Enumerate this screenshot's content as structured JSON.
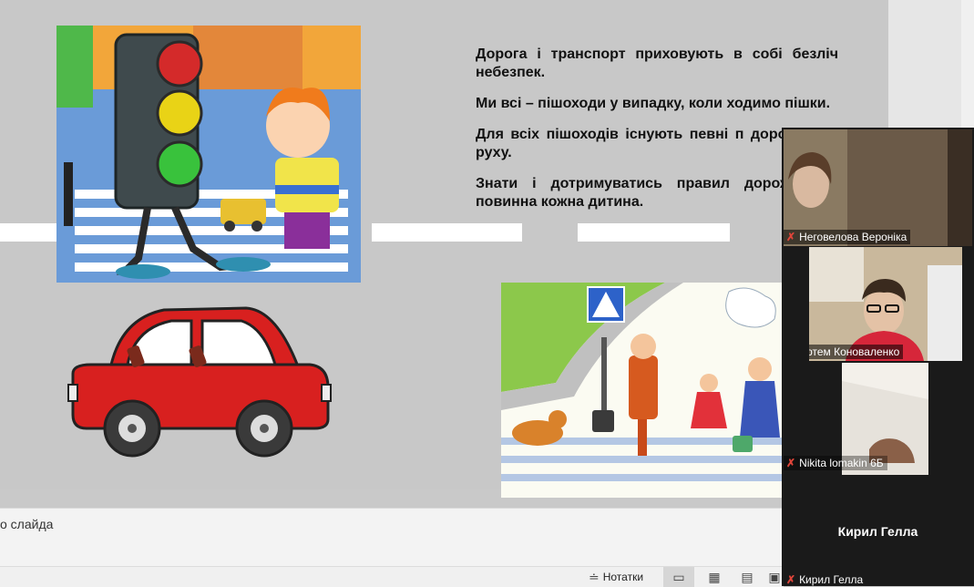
{
  "slide": {
    "paragraphs": [
      "Дорога і транспорт приховують в собі безліч небезпек.",
      "Ми всі – пішоходи у випадку, коли ходимо пішки.",
      "Для всіх пішоходів існують певні п дорожнього руху.",
      "Знати і дотримуватись правил дорож руху повинна кожна дитина."
    ]
  },
  "notes": {
    "placeholder_fragment": "о слайда"
  },
  "statusbar": {
    "notes_label": "Нотатки",
    "icons": [
      "notes-icon",
      "normal-view-icon",
      "slide-sorter-icon",
      "reading-view-icon",
      "slideshow-icon"
    ]
  },
  "colors": {
    "car_red": "#d8201f",
    "panel_bg": "#1a1a1a",
    "slide_bg": "#c8c8c8"
  },
  "participants": [
    {
      "name": "Неговелова Вероніка",
      "muted": true
    },
    {
      "name": "Артем Коноваленко",
      "muted": true
    },
    {
      "name": "Nikita lomakin 6Б",
      "muted": true
    },
    {
      "name": "Кирил Гелла",
      "muted": true,
      "display_name": "Кирил Гелла"
    }
  ]
}
